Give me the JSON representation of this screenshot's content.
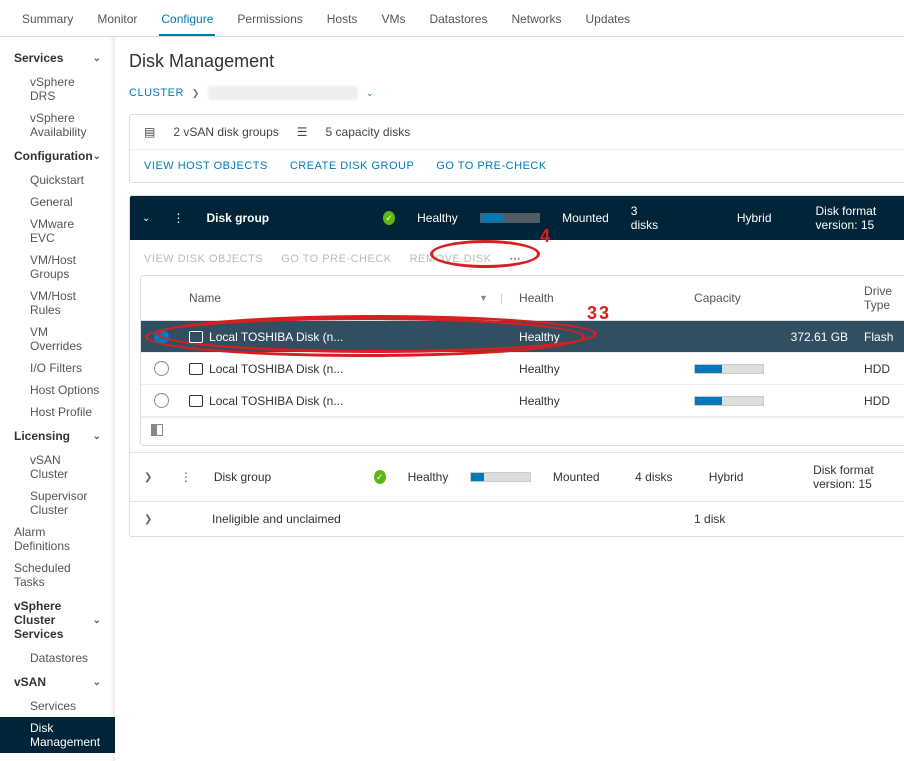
{
  "tabs": [
    "Summary",
    "Monitor",
    "Configure",
    "Permissions",
    "Hosts",
    "VMs",
    "Datastores",
    "Networks",
    "Updates"
  ],
  "activeTab": "Configure",
  "sidebar": [
    {
      "group": "Services",
      "items": [
        "vSphere DRS",
        "vSphere Availability"
      ]
    },
    {
      "group": "Configuration",
      "items": [
        "Quickstart",
        "General",
        "VMware EVC",
        "VM/Host Groups",
        "VM/Host Rules",
        "VM Overrides",
        "I/O Filters",
        "Host Options",
        "Host Profile"
      ]
    },
    {
      "group": "Licensing",
      "items": [
        "vSAN Cluster",
        "Supervisor Cluster"
      ]
    },
    {
      "group": "",
      "items": [
        "Alarm Definitions",
        "Scheduled Tasks"
      ]
    },
    {
      "group": "vSphere Cluster Services",
      "items": [
        "Datastores"
      ]
    },
    {
      "group": "vSAN",
      "items": [
        "Services",
        "Disk Management"
      ]
    }
  ],
  "activeItem": "Disk Management",
  "pageTitle": "Disk Management",
  "breadcrumb": {
    "root": "CLUSTER"
  },
  "card": {
    "summary1": "2 vSAN disk groups",
    "summary2": "5 capacity disks",
    "actions": [
      "VIEW HOST OBJECTS",
      "CREATE DISK GROUP",
      "GO TO PRE-CHECK"
    ]
  },
  "diskGroup": {
    "label": "Disk group",
    "health": "Healthy",
    "mount": "Mounted",
    "disks": "3 disks",
    "type": "Hybrid",
    "format": "Disk format version: 15",
    "fill": 38
  },
  "subActions": [
    "VIEW DISK OBJECTS",
    "GO TO PRE-CHECK",
    "REMOVE DISK"
  ],
  "table": {
    "headers": {
      "name": "Name",
      "health": "Health",
      "capacity": "Capacity",
      "drive": "Drive Type"
    },
    "rows": [
      {
        "name": "Local TOSHIBA Disk (n...",
        "health": "Healthy",
        "cap": "372.61 GB",
        "type": "Flash",
        "selected": true,
        "fill": 0
      },
      {
        "name": "Local TOSHIBA Disk (n...",
        "health": "Healthy",
        "cap": "",
        "type": "HDD",
        "selected": false,
        "fill": 40
      },
      {
        "name": "Local TOSHIBA Disk (n...",
        "health": "Healthy",
        "cap": "",
        "type": "HDD",
        "selected": false,
        "fill": 40
      }
    ]
  },
  "summaryRows": [
    {
      "label": "Disk group",
      "health": "Healthy",
      "mount": "Mounted",
      "disks": "4 disks",
      "type": "Hybrid",
      "format": "Disk format version: 15",
      "fill": 22,
      "dots": true
    },
    {
      "label": "Ineligible and unclaimed",
      "health": "",
      "mount": "",
      "disks": "1 disk",
      "type": "",
      "format": "",
      "fill": null,
      "dots": false
    }
  ],
  "anno": {
    "n3": "3",
    "n4": "4"
  }
}
